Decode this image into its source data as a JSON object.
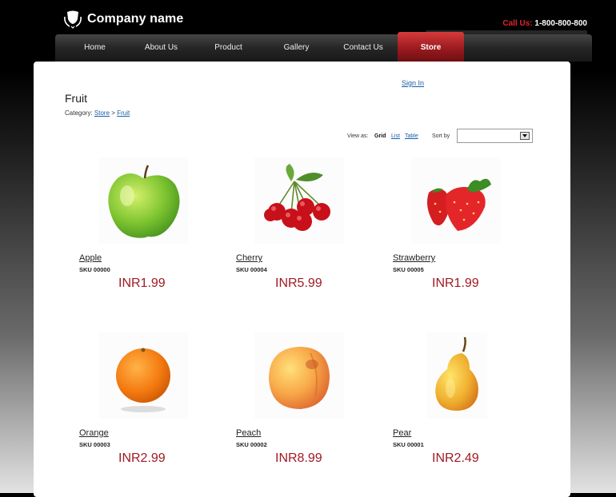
{
  "header": {
    "company_name": "Company name",
    "call_label": "Call Us:",
    "phone": "1-800-800-800"
  },
  "nav": {
    "items": [
      {
        "label": "Home"
      },
      {
        "label": "About Us"
      },
      {
        "label": "Product"
      },
      {
        "label": "Gallery"
      },
      {
        "label": "Contact Us"
      },
      {
        "label": "Store",
        "active": true
      }
    ]
  },
  "account": {
    "sign_in": "Sign In"
  },
  "page": {
    "title": "Fruit",
    "category_label": "Category:",
    "breadcrumb": [
      "Store",
      "Fruit"
    ],
    "breadcrumb_sep": ">"
  },
  "toolbar": {
    "view_as": "View as:",
    "views": [
      "Grid",
      "List",
      "Table"
    ],
    "active_view": "Grid",
    "sort_by": "Sort by",
    "sort_value": ""
  },
  "products": [
    {
      "name": "Apple",
      "sku": "SKU 00000",
      "price": "INR1.99",
      "icon": "apple-image"
    },
    {
      "name": "Cherry",
      "sku": "SKU 00004",
      "price": "INR5.99",
      "icon": "cherry-image"
    },
    {
      "name": "Strawberry",
      "sku": "SKU 00005",
      "price": "INR1.99",
      "icon": "strawberry-image"
    },
    {
      "name": "Orange",
      "sku": "SKU 00003",
      "price": "INR2.99",
      "icon": "orange-image"
    },
    {
      "name": "Peach",
      "sku": "SKU 00002",
      "price": "INR8.99",
      "icon": "peach-image"
    },
    {
      "name": "Pear",
      "sku": "SKU 00001",
      "price": "INR2.49",
      "icon": "pear-image"
    }
  ],
  "colors": {
    "accent_red": "#a11a23",
    "link_blue": "#1a5ea8",
    "nav_active": "#b3262b"
  }
}
